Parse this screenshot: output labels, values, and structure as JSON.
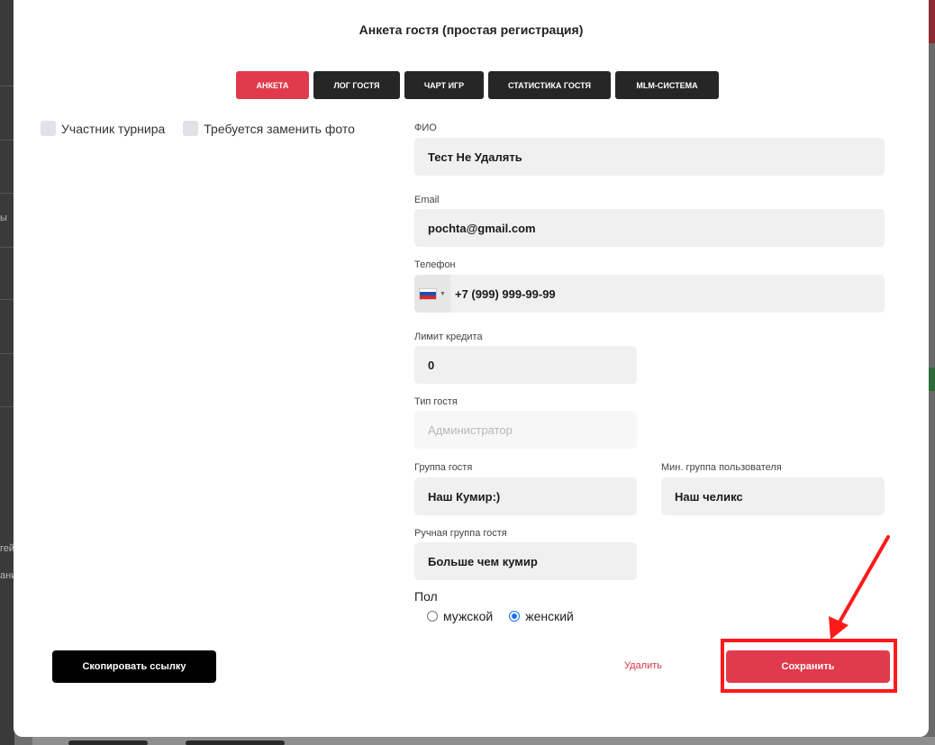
{
  "background": {
    "left_fragments": [
      "ы",
      "гей",
      "ани"
    ]
  },
  "modal": {
    "title": "Анкета гостя (простая регистрация)"
  },
  "tabs": [
    {
      "label": "АНКЕТА",
      "active": true
    },
    {
      "label": "ЛОГ ГОСТЯ",
      "active": false
    },
    {
      "label": "ЧАРТ ИГР",
      "active": false
    },
    {
      "label": "СТАТИСТИКА ГОСТЯ",
      "active": false
    },
    {
      "label": "MLM-СИСТЕМА",
      "active": false
    }
  ],
  "checkboxes": [
    {
      "label": "Участник турнира",
      "checked": false
    },
    {
      "label": "Требуется заменить фото",
      "checked": false
    }
  ],
  "form": {
    "fio": {
      "label": "ФИО",
      "value": "Тест Не Удалять"
    },
    "email": {
      "label": "Email",
      "value": "pochta@gmail.com"
    },
    "phone": {
      "label": "Телефон",
      "value": "+7 (999) 999-99-99",
      "country_flag": "russia-flag-icon"
    },
    "credit_limit": {
      "label": "Лимит кредита",
      "value": "0"
    },
    "guest_type": {
      "label": "Тип гостя",
      "placeholder": "Администратор"
    },
    "guest_group": {
      "label": "Группа гостя",
      "value": "Наш Кумир:)"
    },
    "min_user_group": {
      "label": "Мин. группа пользователя",
      "value": "Наш челикс"
    },
    "manual_group": {
      "label": "Ручная группа гостя",
      "value": "Больше чем кумир"
    },
    "gender": {
      "label": "Пол",
      "options": [
        {
          "label": "мужской",
          "selected": false
        },
        {
          "label": "женский",
          "selected": true
        }
      ]
    }
  },
  "actions": {
    "copy_link": "Скопировать ссылку",
    "delete": "Удалить",
    "save": "Сохранить"
  },
  "colors": {
    "accent": "#e03a4c",
    "dark": "#262626",
    "annotation": "#ff1a1a"
  }
}
